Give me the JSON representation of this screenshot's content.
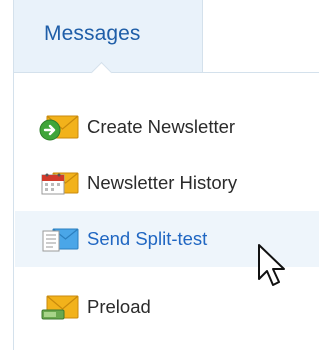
{
  "tab": {
    "label": "Messages"
  },
  "menu": {
    "items": [
      {
        "label": "Create Newsletter",
        "icon": "create-newsletter-icon"
      },
      {
        "label": "Newsletter History",
        "icon": "newsletter-history-icon"
      },
      {
        "label": "Send Split-test",
        "icon": "split-test-icon",
        "hovered": true
      },
      {
        "label": "Preload",
        "icon": "preload-icon"
      }
    ]
  },
  "colors": {
    "tab_background": "#e9f2fa",
    "tab_text": "#1f5ea8",
    "hover_background": "#eef5fb",
    "hover_text": "#1f66c2",
    "item_text": "#2b2b2b"
  }
}
